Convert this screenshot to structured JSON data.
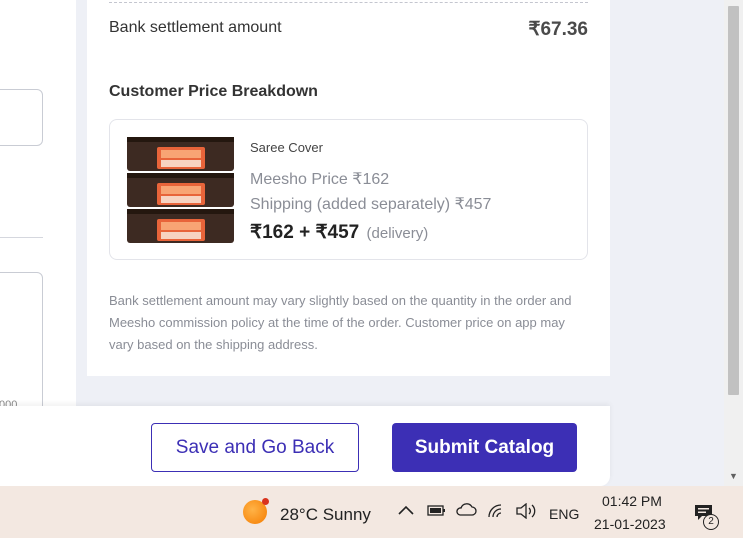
{
  "summary": {
    "settlement_label": "Bank settlement amount",
    "settlement_value": "₹67.36",
    "breakdown_title": "Customer Price Breakdown"
  },
  "product": {
    "name": "Saree Cover",
    "meesho_price": "Meesho Price ₹162",
    "shipping": "Shipping (added separately) ₹457",
    "total": "₹162 + ₹457",
    "total_note": "(delivery)"
  },
  "disclaimer": "Bank settlement amount may vary slightly based on the quantity in the order and Meesho commission policy at the time of the order. Customer price on app may vary based on the shipping address.",
  "left_fragment": "000",
  "actions": {
    "save_back": "Save and Go Back",
    "submit": "Submit Catalog"
  },
  "colors": {
    "primary": "#3c2fb5",
    "muted_text": "#8a8d96"
  },
  "taskbar": {
    "weather": "28°C  Sunny",
    "language": "ENG",
    "time": "01:42 PM",
    "date": "21-01-2023",
    "notification_count": "2"
  }
}
